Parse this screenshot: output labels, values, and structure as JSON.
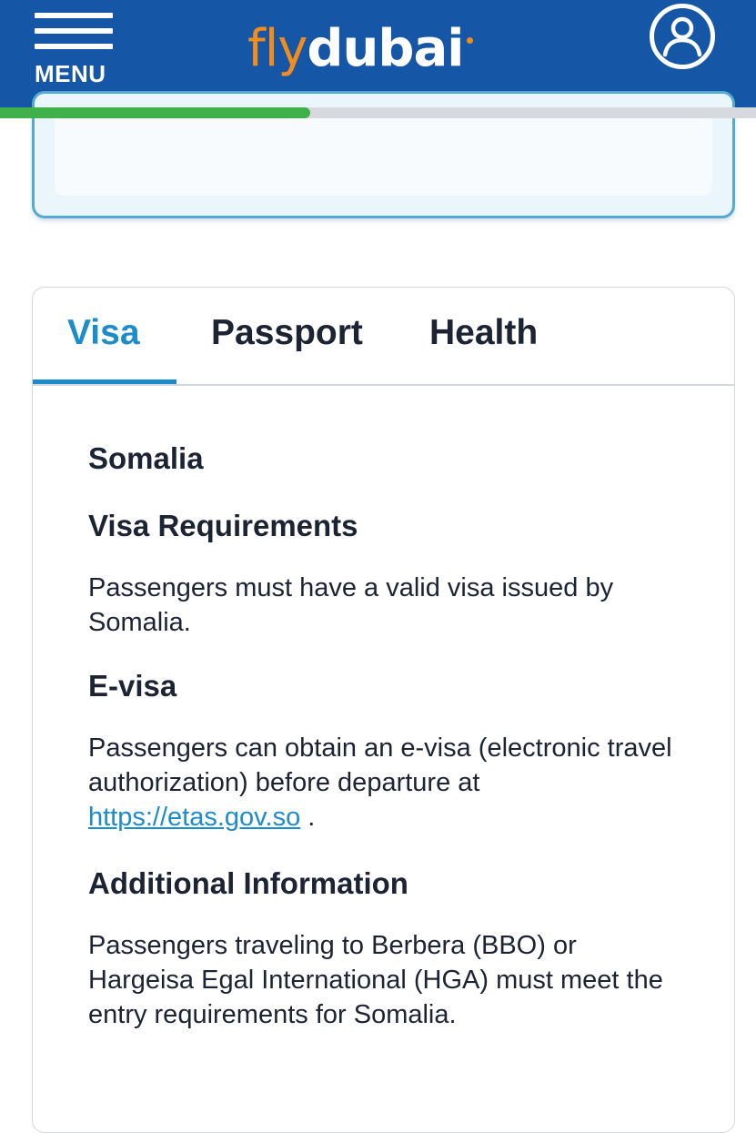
{
  "header": {
    "menu_label": "MENU",
    "logo_fly": "fly",
    "logo_dubai": "dubai",
    "menu_icon": "hamburger-icon",
    "profile_icon": "user-circle-icon",
    "background_color": "#1556a6",
    "logo_accent_color": "#f28c1c"
  },
  "progress": {
    "fraction": 0.41,
    "fill_color": "#3fb04a",
    "track_color": "#d6d9de"
  },
  "tabs": [
    {
      "label": "Visa",
      "active": true
    },
    {
      "label": "Passport",
      "active": false
    },
    {
      "label": "Health",
      "active": false
    }
  ],
  "content": {
    "country": "Somalia",
    "visa_requirements_heading": "Visa Requirements",
    "visa_requirements_text": "Passengers must have a valid visa issued by Somalia.",
    "evisa_heading": "E-visa",
    "evisa_text_before": "Passengers can obtain an e-visa (electronic travel authorization) before departure at ",
    "evisa_link": "https://etas.gov.so",
    "evisa_text_after": " .",
    "additional_heading": "Additional Information",
    "additional_text": "Passengers traveling to Berbera (BBO) or Hargeisa Egal International (HGA) must meet the entry requirements for Somalia."
  },
  "colors": {
    "accent": "#1d8ccb",
    "text": "#1c2333",
    "card_border": "#55aad2"
  }
}
